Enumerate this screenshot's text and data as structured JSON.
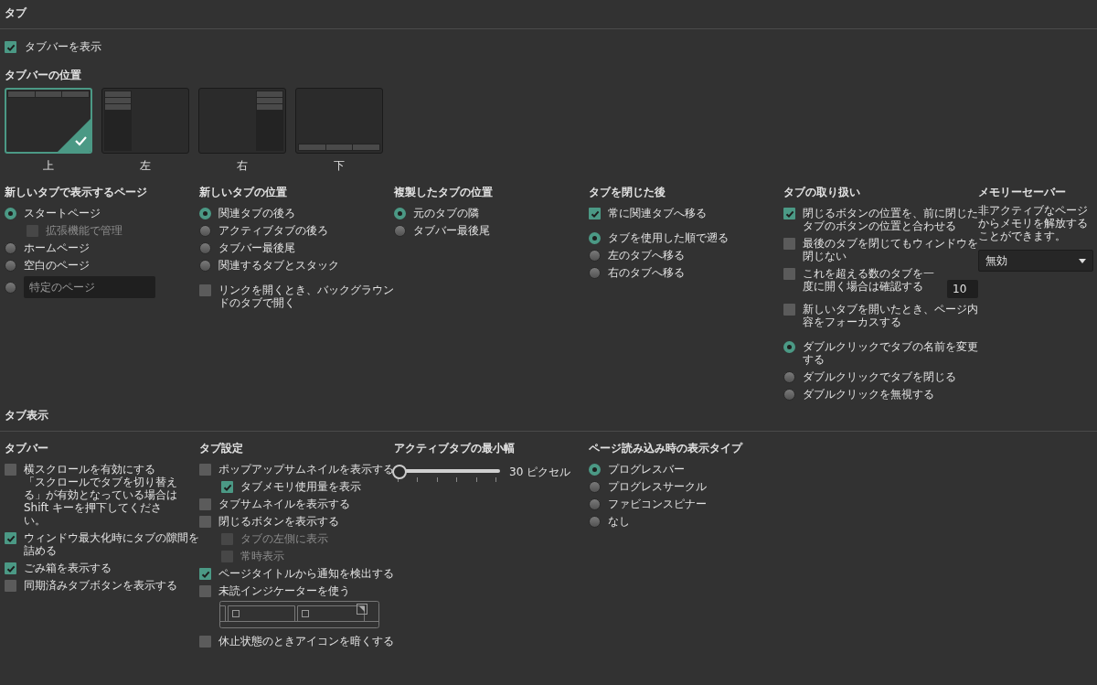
{
  "tabs_section": {
    "heading": "タブ",
    "show_tabbar": {
      "label": "タブバーを表示",
      "checked": true
    },
    "position": {
      "heading": "タブバーの位置",
      "options": [
        {
          "label": "上",
          "kind": "top",
          "selected": true
        },
        {
          "label": "左",
          "kind": "left",
          "selected": false
        },
        {
          "label": "右",
          "kind": "right",
          "selected": false
        },
        {
          "label": "下",
          "kind": "bottom",
          "selected": false
        }
      ]
    },
    "columns": [
      {
        "heading": "新しいタブで表示するページ",
        "groups": [
          [
            {
              "kind": "radio",
              "label": "スタートページ",
              "selected": true,
              "children": [
                {
                  "kind": "checkbox",
                  "label": "拡張機能で管理",
                  "checked": false,
                  "disabled": true
                }
              ]
            },
            {
              "kind": "radio",
              "label": "ホームページ",
              "selected": false
            },
            {
              "kind": "radio",
              "label": "空白のページ",
              "selected": false
            },
            {
              "kind": "radio-input",
              "placeholder": "特定のページ",
              "selected": false
            }
          ]
        ]
      },
      {
        "heading": "新しいタブの位置",
        "groups": [
          [
            {
              "kind": "radio",
              "label": "関連タブの後ろ",
              "selected": true
            },
            {
              "kind": "radio",
              "label": "アクティブタブの後ろ",
              "selected": false
            },
            {
              "kind": "radio",
              "label": "タブバー最後尾",
              "selected": false
            },
            {
              "kind": "radio",
              "label": "関連するタブとスタック",
              "selected": false
            }
          ],
          [
            {
              "kind": "checkbox",
              "label": "リンクを開くとき、バックグラウンドのタブで開く",
              "checked": false
            }
          ]
        ]
      },
      {
        "heading": "複製したタブの位置",
        "groups": [
          [
            {
              "kind": "radio",
              "label": "元のタブの隣",
              "selected": true
            },
            {
              "kind": "radio",
              "label": "タブバー最後尾",
              "selected": false
            }
          ]
        ]
      },
      {
        "heading": "タブを閉じた後",
        "groups": [
          [
            {
              "kind": "checkbox",
              "label": "常に関連タブへ移る",
              "checked": true
            }
          ],
          [
            {
              "kind": "radio",
              "label": "タブを使用した順で遡る",
              "selected": true
            },
            {
              "kind": "radio",
              "label": "左のタブへ移る",
              "selected": false
            },
            {
              "kind": "radio",
              "label": "右のタブへ移る",
              "selected": false
            }
          ]
        ]
      },
      {
        "heading": "タブの取り扱い",
        "groups": [
          [
            {
              "kind": "checkbox",
              "label": "閉じるボタンの位置を、前に閉じたタブのボタンの位置と合わせる",
              "checked": true
            },
            {
              "kind": "checkbox",
              "label": "最後のタブを閉じてもウィンドウを閉じない",
              "checked": false
            },
            {
              "kind": "checkbox-number",
              "label": "これを超える数のタブを一度に開く場合は確認する",
              "checked": false,
              "value": "10"
            },
            {
              "kind": "checkbox",
              "label": "新しいタブを開いたとき、ページ内容をフォーカスする",
              "checked": false
            }
          ],
          [
            {
              "kind": "radio",
              "label": "ダブルクリックでタブの名前を変更する",
              "selected": true
            },
            {
              "kind": "radio",
              "label": "ダブルクリックでタブを閉じる",
              "selected": false
            },
            {
              "kind": "radio",
              "label": "ダブルクリックを無視する",
              "selected": false
            }
          ]
        ]
      },
      {
        "heading": "メモリーセーバー",
        "groups": [
          [
            {
              "kind": "text",
              "text": "非アクティブなページからメモリを解放することができます。"
            },
            {
              "kind": "dropdown",
              "value": "無効"
            }
          ]
        ]
      }
    ]
  },
  "display_section": {
    "heading": "タブ表示",
    "columns": [
      {
        "heading": "タブバー",
        "groups": [
          [
            {
              "kind": "checkbox",
              "label": "横スクロールを有効にする",
              "checked": false,
              "note": "「スクロールでタブを切り替える」が有効となっている場合は Shift キーを押下してください。"
            },
            {
              "kind": "checkbox",
              "label": "ウィンドウ最大化時にタブの隙間を詰める",
              "checked": true
            },
            {
              "kind": "checkbox",
              "label": "ごみ箱を表示する",
              "checked": true
            },
            {
              "kind": "checkbox",
              "label": "同期済みタブボタンを表示する",
              "checked": false
            }
          ]
        ]
      },
      {
        "heading": "タブ設定",
        "groups": [
          [
            {
              "kind": "checkbox",
              "label": "ポップアップサムネイルを表示する",
              "checked": false,
              "children": [
                {
                  "kind": "checkbox",
                  "label": "タブメモリ使用量を表示",
                  "checked": true,
                  "disabled": false
                }
              ]
            },
            {
              "kind": "checkbox",
              "label": "タブサムネイルを表示する",
              "checked": false
            },
            {
              "kind": "checkbox",
              "label": "閉じるボタンを表示する",
              "checked": false,
              "children": [
                {
                  "kind": "checkbox",
                  "label": "タブの左側に表示",
                  "checked": false,
                  "disabled": true
                },
                {
                  "kind": "checkbox",
                  "label": "常時表示",
                  "checked": false,
                  "disabled": true
                }
              ]
            },
            {
              "kind": "checkbox",
              "label": "ページタイトルから通知を検出する",
              "checked": true
            },
            {
              "kind": "checkbox",
              "label": "未読インジケーターを使う",
              "checked": false
            },
            {
              "kind": "preview"
            },
            {
              "kind": "checkbox",
              "label": "休止状態のときアイコンを暗くする",
              "checked": false
            }
          ]
        ]
      },
      {
        "heading": "アクティブタブの最小幅",
        "groups": [
          [
            {
              "kind": "slider",
              "level": 0,
              "reading": "30 ピクセル"
            }
          ]
        ]
      },
      {
        "heading": "ページ読み込み時の表示タイプ",
        "groups": [
          [
            {
              "kind": "radio",
              "label": "プログレスバー",
              "selected": true
            },
            {
              "kind": "radio",
              "label": "プログレスサークル",
              "selected": false
            },
            {
              "kind": "radio",
              "label": "ファビコンスピナー",
              "selected": false
            },
            {
              "kind": "radio",
              "label": "なし",
              "selected": false
            }
          ]
        ]
      }
    ]
  }
}
